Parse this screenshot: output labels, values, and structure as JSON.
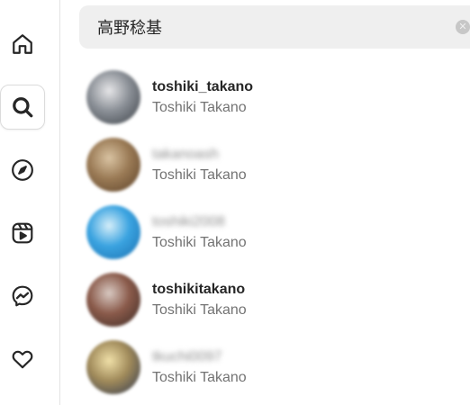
{
  "search": {
    "value": "高野稔基",
    "clear_glyph": "✕"
  },
  "nav": [
    {
      "name": "home-icon",
      "active": false
    },
    {
      "name": "search-icon",
      "active": true
    },
    {
      "name": "explore-icon",
      "active": false
    },
    {
      "name": "reels-icon",
      "active": false
    },
    {
      "name": "messenger-icon",
      "active": false
    },
    {
      "name": "notifications-heart-icon",
      "active": false
    }
  ],
  "results": [
    {
      "username": "toshiki_takano",
      "fullname": "Toshiki Takano",
      "blurred": false,
      "avatar_colors": [
        "#e6e6e8",
        "#8a8f96",
        "#3a3f45"
      ]
    },
    {
      "username": "takanoash",
      "fullname": "Toshiki Takano",
      "blurred": true,
      "avatar_colors": [
        "#d9c3a2",
        "#9a7a55",
        "#5a4028"
      ]
    },
    {
      "username": "toshiki2008",
      "fullname": "Toshiki Takano",
      "blurred": true,
      "avatar_colors": [
        "#d6eef9",
        "#3aa3e0",
        "#1a6fb0"
      ]
    },
    {
      "username": "toshikitakano",
      "fullname": "Toshiki Takano",
      "blurred": false,
      "avatar_colors": [
        "#d8c9c2",
        "#8a5a4a",
        "#3a2a25"
      ]
    },
    {
      "username": "tkuchi0097",
      "fullname": "Toshiki Takano",
      "blurred": true,
      "avatar_colors": [
        "#f0e0a8",
        "#a08a5a",
        "#2c3650"
      ]
    }
  ]
}
